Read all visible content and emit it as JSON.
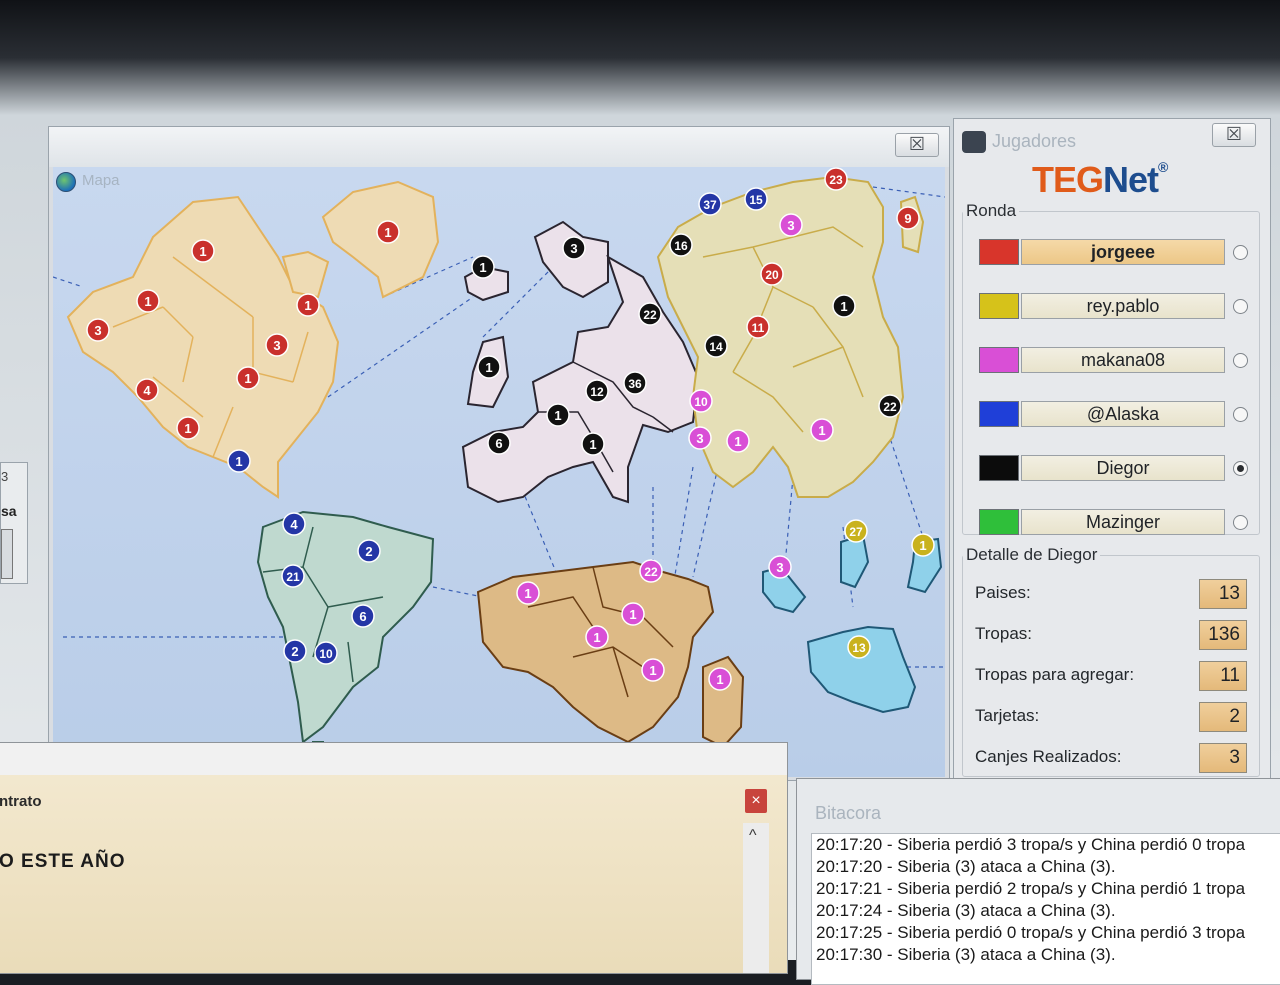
{
  "map_window": {
    "title": "Mapa",
    "close_label": "☒",
    "continents": [
      {
        "name": "north-america",
        "fill": "#eedbb4",
        "stroke": "#e3b25c"
      },
      {
        "name": "south-america",
        "fill": "#bfd9cf",
        "stroke": "#2f5c4e"
      },
      {
        "name": "europe",
        "fill": "#ebe1ea",
        "stroke": "#2a2530"
      },
      {
        "name": "asia",
        "fill": "#e5dfb7",
        "stroke": "#c9ac4a"
      },
      {
        "name": "africa",
        "fill": "#ddba86",
        "stroke": "#6a3e14"
      },
      {
        "name": "oceania",
        "fill": "#8fd1ea",
        "stroke": "#1f5876"
      }
    ],
    "armies": [
      {
        "label": "1",
        "color": "#c9302c"
      },
      {
        "label": "1",
        "color": "#c9302c"
      },
      {
        "label": "3",
        "color": "#c9302c"
      },
      {
        "label": "1",
        "color": "#c9302c"
      },
      {
        "label": "1",
        "color": "#c9302c"
      },
      {
        "label": "3",
        "color": "#c9302c"
      },
      {
        "label": "4",
        "color": "#c9302c"
      },
      {
        "label": "1",
        "color": "#c9302c"
      },
      {
        "label": "1",
        "color": "#c9302c"
      },
      {
        "label": "1",
        "color": "#2436a6"
      },
      {
        "label": "4",
        "color": "#2436a6"
      },
      {
        "label": "2",
        "color": "#2436a6"
      },
      {
        "label": "21",
        "color": "#2436a6"
      },
      {
        "label": "6",
        "color": "#2436a6"
      },
      {
        "label": "2",
        "color": "#2436a6"
      },
      {
        "label": "10",
        "color": "#2436a6"
      },
      {
        "label": "1",
        "color": "#111111"
      },
      {
        "label": "3",
        "color": "#111111"
      },
      {
        "label": "22",
        "color": "#111111"
      },
      {
        "label": "1",
        "color": "#111111"
      },
      {
        "label": "12",
        "color": "#111111"
      },
      {
        "label": "36",
        "color": "#111111"
      },
      {
        "label": "1",
        "color": "#111111"
      },
      {
        "label": "6",
        "color": "#111111"
      },
      {
        "label": "1",
        "color": "#111111"
      },
      {
        "label": "16",
        "color": "#111111"
      },
      {
        "label": "14",
        "color": "#111111"
      },
      {
        "label": "1",
        "color": "#111111"
      },
      {
        "label": "22",
        "color": "#111111"
      },
      {
        "label": "37",
        "color": "#2436a6"
      },
      {
        "label": "15",
        "color": "#2436a6"
      },
      {
        "label": "23",
        "color": "#c9302c"
      },
      {
        "label": "9",
        "color": "#c9302c"
      },
      {
        "label": "3",
        "color": "#d94fd6"
      },
      {
        "label": "20",
        "color": "#c9302c"
      },
      {
        "label": "11",
        "color": "#c9302c"
      },
      {
        "label": "10",
        "color": "#d94fd6"
      },
      {
        "label": "3",
        "color": "#d94fd6"
      },
      {
        "label": "1",
        "color": "#d94fd6"
      },
      {
        "label": "1",
        "color": "#d94fd6"
      },
      {
        "label": "1",
        "color": "#d94fd6"
      },
      {
        "label": "22",
        "color": "#d94fd6"
      },
      {
        "label": "1",
        "color": "#d94fd6"
      },
      {
        "label": "1",
        "color": "#d94fd6"
      },
      {
        "label": "1",
        "color": "#d94fd6"
      },
      {
        "label": "1",
        "color": "#d94fd6"
      },
      {
        "label": "3",
        "color": "#d94fd6"
      },
      {
        "label": "27",
        "color": "#c9b21d"
      },
      {
        "label": "1",
        "color": "#c9b21d"
      },
      {
        "label": "13",
        "color": "#c9b21d"
      }
    ]
  },
  "players_window": {
    "title": "Jugadores",
    "close_label": "☒",
    "logo": {
      "teg": "TEG",
      "net": "Net",
      "reg": "®"
    },
    "ronda_legend": "Ronda",
    "players": [
      {
        "name": "jorgeee",
        "color": "#d8352b",
        "active": true,
        "checked": false
      },
      {
        "name": "rey.pablo",
        "color": "#d6c21a",
        "active": false,
        "checked": false
      },
      {
        "name": "makana08",
        "color": "#d94fd6",
        "active": false,
        "checked": false
      },
      {
        "name": "@Alaska",
        "color": "#1f3fd8",
        "active": false,
        "checked": false
      },
      {
        "name": "Diegor",
        "color": "#0c0c0c",
        "active": false,
        "checked": true
      },
      {
        "name": "Mazinger",
        "color": "#2fbf3a",
        "active": false,
        "checked": false
      }
    ],
    "detail_legend": "Detalle de Diegor",
    "details": [
      {
        "label": "Paises:",
        "value": "13"
      },
      {
        "label": "Tropas:",
        "value": "136"
      },
      {
        "label": "Tropas para agregar:",
        "value": "11"
      },
      {
        "label": "Tarjetas:",
        "value": "2"
      },
      {
        "label": "Canjes Realizados:",
        "value": "3"
      }
    ]
  },
  "contrato_window": {
    "title": "ntrato",
    "body": "O ESTE AÑO",
    "close_label": "×",
    "scroll_up": "^"
  },
  "bitacora_window": {
    "title": "Bitacora",
    "lines": [
      "20:17:20 - Siberia perdió 3 tropa/s y China perdió 0 tropa",
      "20:17:20 - Siberia (3) ataca a China (3).",
      "20:17:21 - Siberia perdió 2 tropa/s y China perdió 1 tropa",
      "20:17:24 - Siberia (3) ataca a China (3).",
      "20:17:25 - Siberia perdió 0 tropa/s y China perdió 3 tropa",
      "20:17:30 - Siberia (3) ataca a China (3)."
    ]
  },
  "side_window": {
    "text": "sa",
    "top_text": "3"
  }
}
